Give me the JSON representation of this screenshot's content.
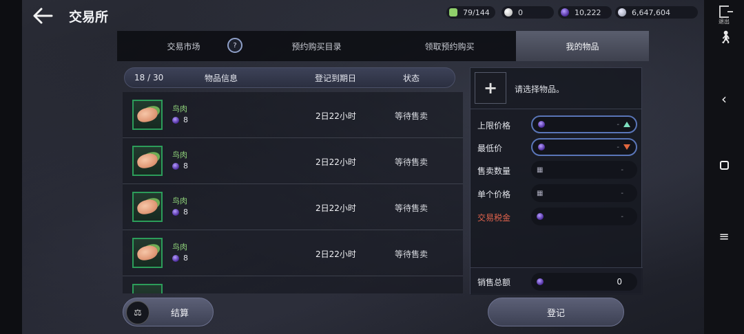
{
  "header": {
    "title": "交易所",
    "currencies": [
      {
        "icon": "energy-icon",
        "value": "79/144",
        "color": "#8fcf6a"
      },
      {
        "icon": "pearl-icon",
        "value": "0",
        "color": "#d9d9d9"
      },
      {
        "icon": "purple-orb-icon",
        "value": "10,222",
        "color": "#7a55d8"
      },
      {
        "icon": "silver-coin-icon",
        "value": "6,647,604",
        "color": "#c8ccd6"
      }
    ],
    "exit_label": "退出"
  },
  "tabs": [
    {
      "label": "交易市场"
    },
    {
      "label": "预约购买目录"
    },
    {
      "label": "领取预约购买"
    },
    {
      "label": "我的物品",
      "active": true
    }
  ],
  "list": {
    "count": "18 / 30",
    "columns": {
      "info": "物品信息",
      "expiry": "登记到期日",
      "status": "状态"
    },
    "items": [
      {
        "name": "鸟肉",
        "qty": "8",
        "expiry": "2日22小时",
        "status": "等待售卖"
      },
      {
        "name": "鸟肉",
        "qty": "8",
        "expiry": "2日22小时",
        "status": "等待售卖"
      },
      {
        "name": "鸟肉",
        "qty": "8",
        "expiry": "2日22小时",
        "status": "等待售卖"
      },
      {
        "name": "鸟肉",
        "qty": "8",
        "expiry": "2日22小时",
        "status": "等待售卖"
      }
    ]
  },
  "panel": {
    "select_prompt": "请选择物品。",
    "fields": {
      "max_price": {
        "label": "上限价格",
        "value": "-"
      },
      "min_price": {
        "label": "最低价",
        "value": "-"
      },
      "sell_qty": {
        "label": "售卖数量",
        "value": "-"
      },
      "unit_price": {
        "label": "单个价格",
        "value": "-"
      },
      "tax": {
        "label": "交易税金",
        "value": "-"
      }
    },
    "total": {
      "label": "销售总额",
      "value": "0"
    }
  },
  "buttons": {
    "settle": "结算",
    "register": "登记"
  }
}
